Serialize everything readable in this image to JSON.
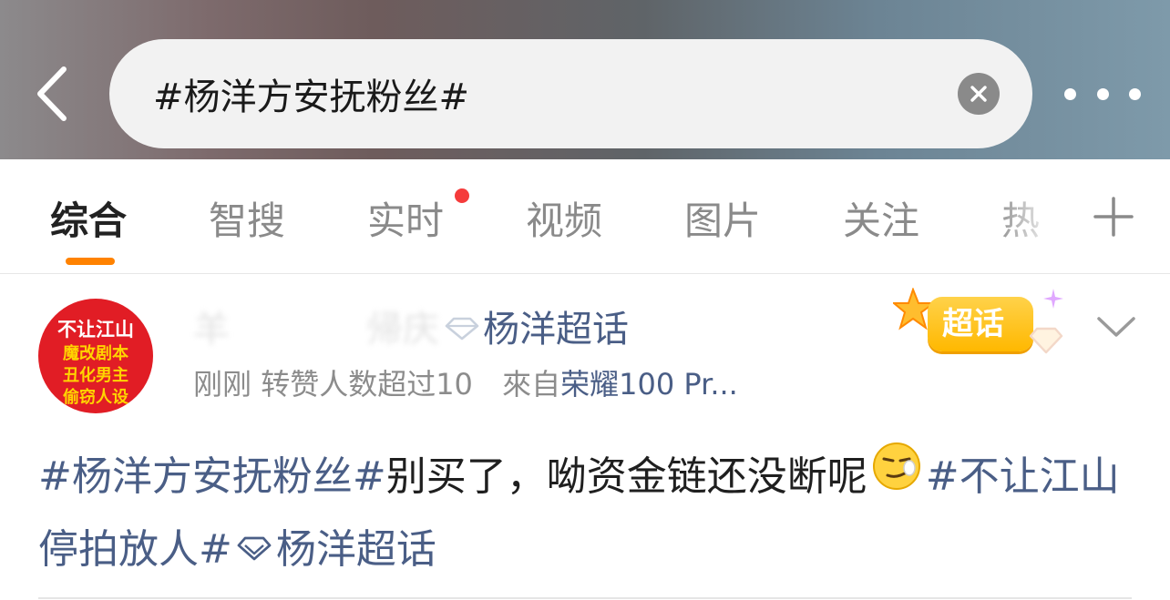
{
  "search": {
    "query": "#杨洋方安抚粉丝#"
  },
  "header_icons": {
    "back": "back-arrow-icon",
    "clear": "clear-x-icon",
    "more": "more-dots-icon"
  },
  "tabs": [
    {
      "label": "综合",
      "active": true
    },
    {
      "label": "智搜",
      "active": false
    },
    {
      "label": "实时",
      "active": false,
      "has_dot": true
    },
    {
      "label": "视频",
      "active": false
    },
    {
      "label": "图片",
      "active": false
    },
    {
      "label": "关注",
      "active": false
    },
    {
      "label": "热",
      "active": false
    }
  ],
  "colors": {
    "accent": "#ff8200",
    "link": "#4a5e86",
    "badge_dot": "#f53b3b",
    "avatar_bg": "#e11d25"
  },
  "post": {
    "avatar": {
      "line1": "不让江山",
      "line2": "魔改剧本",
      "line3": "丑化男主",
      "line4": "偷窃人设"
    },
    "username_obscured": "羊",
    "username_obscured2": "帰庆",
    "supertopic_name": "杨洋超话",
    "time": "刚刚",
    "reposts": "转赞人数超过10",
    "from_label": "來自",
    "device": "荣耀100 Pr...",
    "badge_label": "超话",
    "content": {
      "tag1": "#杨洋方安抚粉丝#",
      "text": "别买了，呦资金链还没断呢",
      "tag2": "#不让江山停拍放人#",
      "tag3": "杨洋超话"
    }
  }
}
